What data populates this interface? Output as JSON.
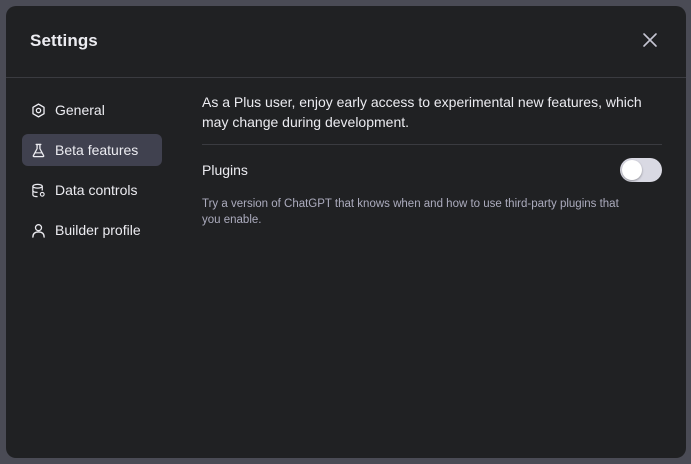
{
  "dialog": {
    "title": "Settings",
    "close_icon": "close-icon"
  },
  "sidebar": {
    "items": [
      {
        "label": "General",
        "icon": "gear-icon",
        "active": false
      },
      {
        "label": "Beta features",
        "icon": "flask-icon",
        "active": true
      },
      {
        "label": "Data controls",
        "icon": "database-icon",
        "active": false
      },
      {
        "label": "Builder profile",
        "icon": "user-icon",
        "active": false
      }
    ]
  },
  "beta": {
    "intro": "As a Plus user, enjoy early access to experimental new features, which may change during development.",
    "plugins": {
      "label": "Plugins",
      "enabled": false,
      "description": "Try a version of ChatGPT that knows when and how to use third-party plugins that you enable."
    }
  },
  "colors": {
    "backdrop": "#4a4b55",
    "dialog_bg": "#202123",
    "active_item_bg": "#40414f",
    "text": "#ececf1",
    "muted_text": "#acacbe",
    "toggle_off": "#d9d9e3"
  }
}
